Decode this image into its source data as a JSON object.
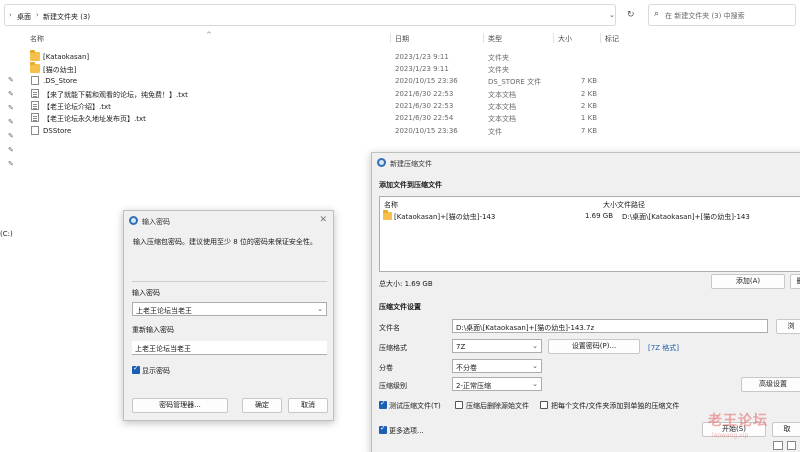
{
  "explorer": {
    "breadcrumb": [
      "桌面",
      "新建文件夹 (3)"
    ],
    "search_placeholder": "在 新建文件夹 (3) 中搜索",
    "columns": {
      "name": "名称",
      "date": "日期",
      "type": "类型",
      "size": "大小",
      "tags": "标记"
    },
    "files": [
      {
        "name": "[Kataokasan]",
        "date": "2023/1/23 9:11",
        "type": "文件夹",
        "size": "",
        "icon": "folder-icon"
      },
      {
        "name": "[猫の幼虫]",
        "date": "2023/1/23 9:11",
        "type": "文件夹",
        "size": "",
        "icon": "folder-icon"
      },
      {
        "name": ".DS_Store",
        "date": "2020/10/15 23:36",
        "type": "DS_STORE 文件",
        "size": "7 KB",
        "icon": "file-icon"
      },
      {
        "name": "【来了就能下载和观看的论坛，纯免费！】.txt",
        "date": "2021/6/30 22:53",
        "type": "文本文档",
        "size": "2 KB",
        "icon": "text-file-icon"
      },
      {
        "name": "【老王论坛介绍】.txt",
        "date": "2021/6/30 22:53",
        "type": "文本文档",
        "size": "2 KB",
        "icon": "text-file-icon"
      },
      {
        "name": "【老王论坛永久地址发布页】.txt",
        "date": "2021/6/30 22:54",
        "type": "文本文档",
        "size": "1 KB",
        "icon": "text-file-icon"
      },
      {
        "name": "DSStore",
        "date": "2020/10/15 23:36",
        "type": "文件",
        "size": "7 KB",
        "icon": "file-icon"
      }
    ],
    "drive_label": "(C:)"
  },
  "password_dialog": {
    "title": "输入密码",
    "instruction": "输入压缩包密码。建议使用至少 8 位的密码来保证安全性。",
    "enter_label": "输入密码",
    "password_value": "上老王论坛当老王",
    "reenter_label": "重新输入密码",
    "reenter_value": "上老王论坛当老王",
    "show_password_label": "显示密码",
    "show_password_checked": true,
    "buttons": {
      "manager": "密码管理器...",
      "ok": "确定",
      "cancel": "取消"
    }
  },
  "archive_dialog": {
    "title": "新建压缩文件",
    "add_section": "添加文件到压缩文件",
    "list_headers": {
      "name": "名称",
      "size": "大小",
      "path": "文件路径"
    },
    "list_items": [
      {
        "name": "[Kataokasan]+[猫の幼虫]-143",
        "size": "1.69 GB",
        "path": "D:\\桌面\\[Kataokasan]+[猫の幼虫]-143"
      }
    ],
    "total_size": "总大小: 1.69 GB",
    "add_button": "添加(A)",
    "delete_button": "删",
    "settings_section": "压缩文件设置",
    "filename_label": "文件名",
    "filename_value": "D:\\桌面\\[Kataokasan]+[猫の幼虫]-143.7z",
    "browse_button": "浏",
    "format_label": "压缩格式",
    "format_value": "7Z",
    "set_password_button": "设置密码(P)...",
    "format_link": "[7Z 格式]",
    "volume_label": "分卷",
    "volume_value": "不分卷",
    "level_label": "压缩级别",
    "level_value": "2-正常压缩",
    "advanced_button": "高级设置",
    "options": [
      {
        "label": "测试压缩文件(T)",
        "checked": true
      },
      {
        "label": "压缩后删除源始文件",
        "checked": false
      },
      {
        "label": "把每个文件/文件夹添加到单独的压缩文件",
        "checked": false
      }
    ],
    "more_options_label": "更多选项...",
    "more_options_checked": true,
    "start_button": "开始(S)",
    "cancel_button": "取"
  },
  "watermark": {
    "text": "老王论坛",
    "sub": "laowang.vip"
  },
  "colors": {
    "accent": "#1a5fb4",
    "folder": "#f6c04d"
  }
}
